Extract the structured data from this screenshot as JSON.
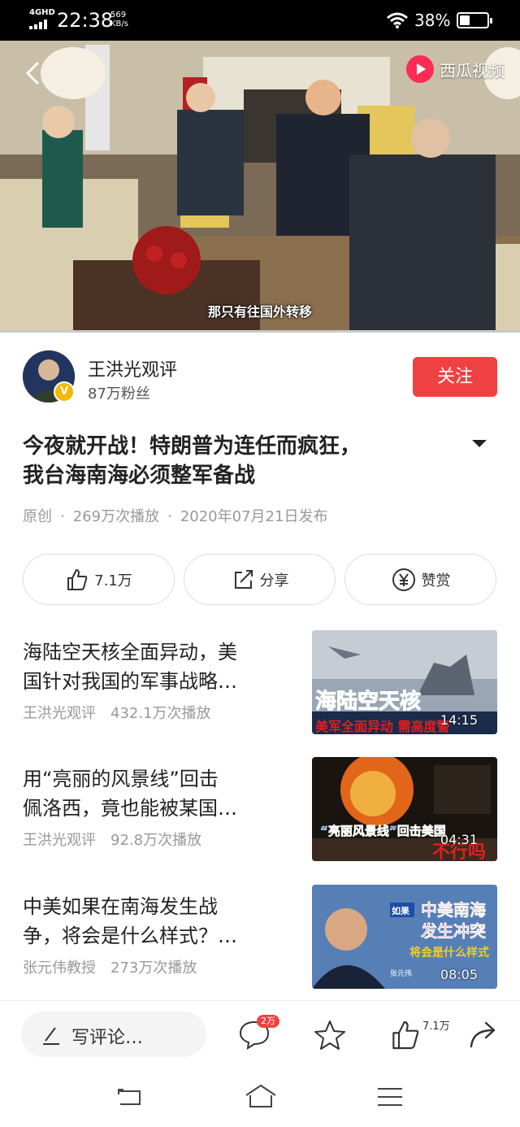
{
  "status_bar": {
    "network": "4GHD",
    "time": "22:38",
    "speed_value": "569",
    "speed_unit": "KB/s",
    "battery_percent": "38%",
    "battery_level": 0.38
  },
  "video": {
    "brand": "西瓜视频",
    "subtitle": "那只有往国外转移"
  },
  "author": {
    "name": "王洪光观评",
    "fans": "87万粉丝",
    "follow_label": "关注",
    "verified_mark": "V"
  },
  "article": {
    "title_line1": "今夜就开战！特朗普为连任而疯狂，",
    "title_line2": "我台海南海必须整军备战",
    "meta_original": "原创",
    "meta_plays": "269万次播放",
    "meta_date": "2020年07月21日发布"
  },
  "actions": {
    "like": "7.1万",
    "share": "分享",
    "reward": "赞赏"
  },
  "related": [
    {
      "title_line1": "海陆空天核全面异动，美",
      "title_line2": "国针对我国的军事战略…",
      "author": "王洪光观评",
      "plays": "432.1万次播放",
      "duration": "14:15",
      "overlay1": "海陆空天核",
      "overlay2": "美军全面异动 需高度警"
    },
    {
      "title_line1": "用“亮丽的风景线”回击",
      "title_line2": "佩洛西，竟也能被某国…",
      "author": "王洪光观评",
      "plays": "92.8万次播放",
      "duration": "04:31",
      "overlay1": "“亮丽风景线”回击美国",
      "overlay2": "不行吗"
    },
    {
      "title_line1": "中美如果在南海发生战",
      "title_line2": "争，将会是什么样式？…",
      "author": "张元伟教授",
      "plays": "273万次播放",
      "duration": "08:05",
      "overlay_tag": "如果",
      "overlay1": "中美南海",
      "overlay2": "发生冲突",
      "overlay3": "将会是什么样式",
      "overlay4": "张元伟"
    }
  ],
  "bottom_bar": {
    "comment_placeholder": "写评论…",
    "comment_count": "2万",
    "like_count": "7.1万"
  }
}
